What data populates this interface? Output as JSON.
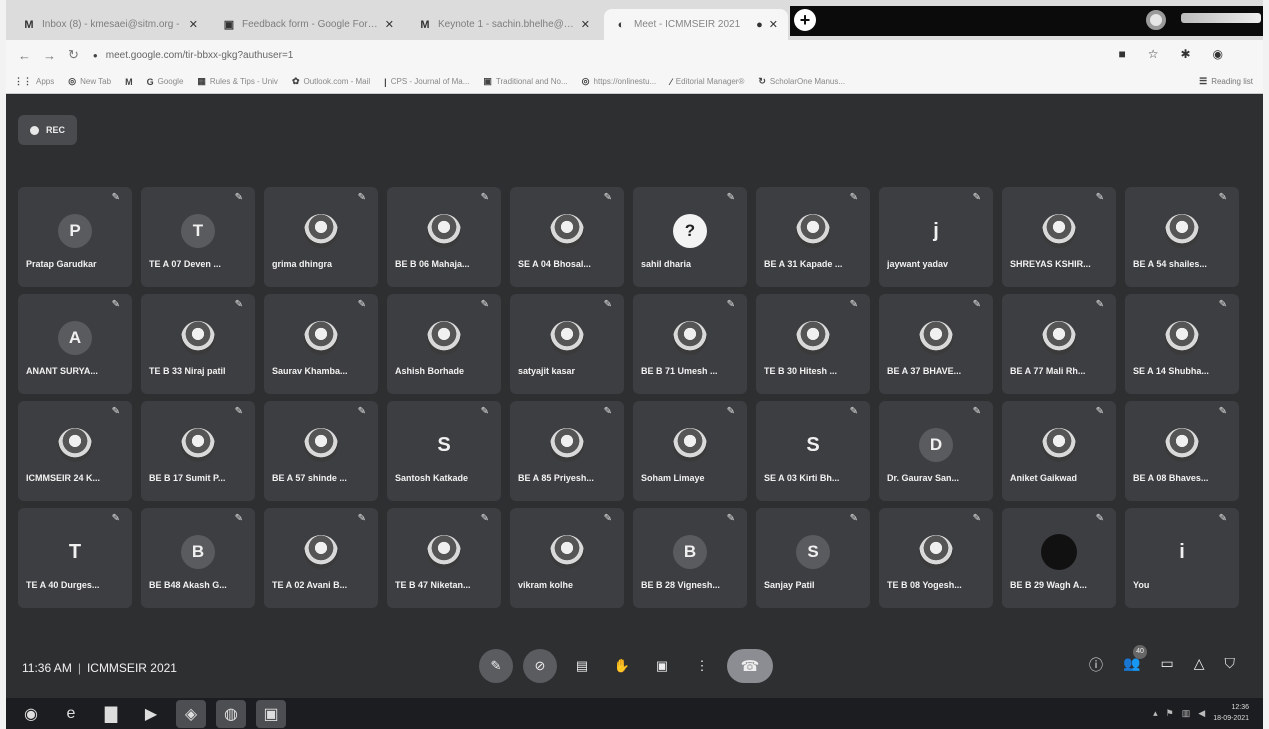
{
  "browser": {
    "tabs": [
      {
        "icon": "M",
        "title": "Inbox (8) - kmesaei@sitm.org -"
      },
      {
        "icon": "▣",
        "title": "Feedback form - Google Forms"
      },
      {
        "icon": "M",
        "title": "Keynote 1 - sachin.bhelhe@sitm"
      },
      {
        "icon": "◐",
        "title": "Meet - ICMMSEIR 2021"
      }
    ],
    "url": "meet.google.com/tir-bbxx-gkg?authuser=1",
    "bookmarks": [
      "Apps",
      "New Tab",
      "Google",
      "Rules & Tips - Univ",
      "Outlook.com - Mail",
      "CPS - Journal of Ma...",
      "Traditional and No...",
      "https://onlinestu...",
      "Editorial Manager®",
      "ScholarOne Manus..."
    ],
    "reading_list": "Reading list"
  },
  "meet": {
    "rec_label": "REC",
    "participants": [
      {
        "name": "Pratap Garudkar",
        "avatar": "letter",
        "letter": "P"
      },
      {
        "name": "TE A 07 Deven ...",
        "avatar": "letter",
        "letter": "T"
      },
      {
        "name": "grima dhingra",
        "avatar": "photo",
        "letter": ""
      },
      {
        "name": "BE B 06 Mahaja...",
        "avatar": "photo",
        "letter": ""
      },
      {
        "name": "SE A 04 Bhosal...",
        "avatar": "photo",
        "letter": ""
      },
      {
        "name": "sahil dharia",
        "avatar": "q",
        "letter": "?"
      },
      {
        "name": "BE A 31 Kapade ...",
        "avatar": "photo",
        "letter": ""
      },
      {
        "name": "jaywant yadav",
        "avatar": "plain",
        "letter": "j"
      },
      {
        "name": "SHREYAS KSHIR...",
        "avatar": "photo",
        "letter": ""
      },
      {
        "name": "BE A 54 shailes...",
        "avatar": "photo",
        "letter": ""
      },
      {
        "name": "ANANT SURYA...",
        "avatar": "letter",
        "letter": "A"
      },
      {
        "name": "TE B 33 Niraj patil",
        "avatar": "photo",
        "letter": ""
      },
      {
        "name": "Saurav Khamba...",
        "avatar": "photo",
        "letter": ""
      },
      {
        "name": "Ashish Borhade",
        "avatar": "photo",
        "letter": ""
      },
      {
        "name": "satyajit kasar",
        "avatar": "photo",
        "letter": ""
      },
      {
        "name": "BE B 71 Umesh ...",
        "avatar": "photo",
        "letter": ""
      },
      {
        "name": "TE B 30 Hitesh ...",
        "avatar": "photo",
        "letter": ""
      },
      {
        "name": "BE A 37 BHAVE...",
        "avatar": "photo",
        "letter": ""
      },
      {
        "name": "BE A 77 Mali Rh...",
        "avatar": "photo",
        "letter": ""
      },
      {
        "name": "SE A 14 Shubha...",
        "avatar": "photo",
        "letter": ""
      },
      {
        "name": "ICMMSEIR 24 K...",
        "avatar": "photo",
        "letter": ""
      },
      {
        "name": "BE B 17 Sumit P...",
        "avatar": "photo",
        "letter": ""
      },
      {
        "name": "BE A 57 shinde ...",
        "avatar": "photo",
        "letter": ""
      },
      {
        "name": "Santosh Katkade",
        "avatar": "plain",
        "letter": "S"
      },
      {
        "name": "BE A 85 Priyesh...",
        "avatar": "photo",
        "letter": ""
      },
      {
        "name": "Soham Limaye",
        "avatar": "photo",
        "letter": ""
      },
      {
        "name": "SE A 03 Kirti Bh...",
        "avatar": "plain",
        "letter": "S"
      },
      {
        "name": "Dr. Gaurav San...",
        "avatar": "letter",
        "letter": "D"
      },
      {
        "name": "Aniket Gaikwad",
        "avatar": "photo",
        "letter": ""
      },
      {
        "name": "BE A 08 Bhaves...",
        "avatar": "photo",
        "letter": ""
      },
      {
        "name": "TE A 40 Durges...",
        "avatar": "plain",
        "letter": "T"
      },
      {
        "name": "BE B48 Akash G...",
        "avatar": "letter",
        "letter": "B"
      },
      {
        "name": "TE A 02 Avani B...",
        "avatar": "photo",
        "letter": ""
      },
      {
        "name": "TE B 47 Niketan...",
        "avatar": "photo",
        "letter": ""
      },
      {
        "name": "vikram kolhe",
        "avatar": "photo",
        "letter": ""
      },
      {
        "name": "BE B 28 Vignesh...",
        "avatar": "letter",
        "letter": "B"
      },
      {
        "name": "Sanjay Patil",
        "avatar": "letter",
        "letter": "S"
      },
      {
        "name": "TE B 08 Yogesh...",
        "avatar": "photo",
        "letter": ""
      },
      {
        "name": "BE B 29 Wagh A...",
        "avatar": "dark",
        "letter": ""
      },
      {
        "name": "You",
        "avatar": "plain",
        "letter": "i"
      }
    ],
    "time": "11:36 AM",
    "meeting_name": "ICMMSEIR 2021",
    "people_count": "40"
  },
  "taskbar": {
    "clock_time": "12:36",
    "clock_date": "18-09-2021"
  }
}
